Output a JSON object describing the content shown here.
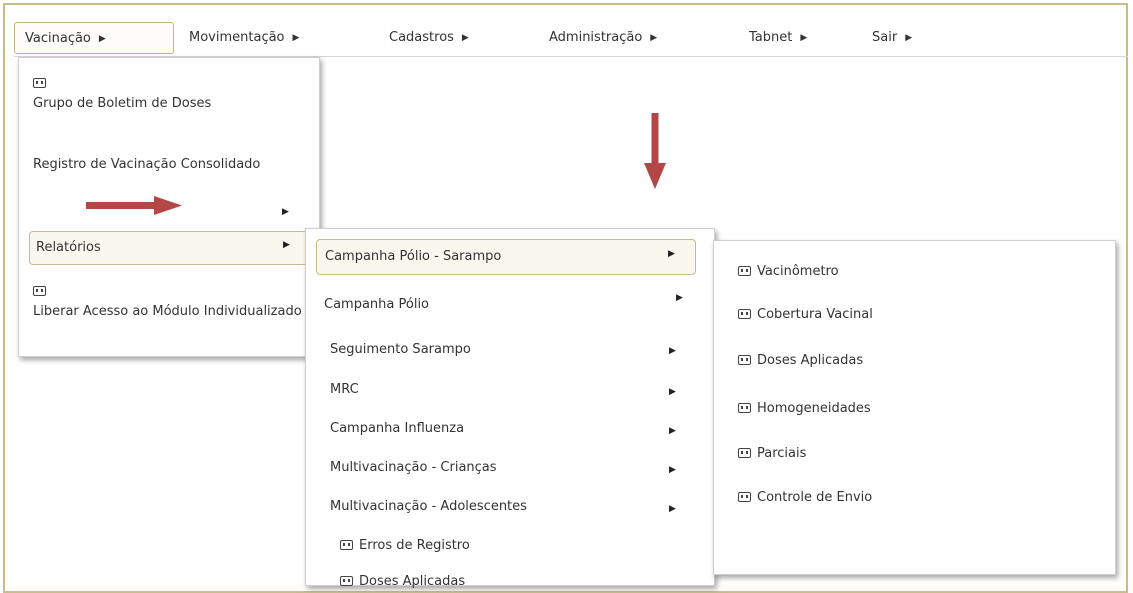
{
  "menubar": {
    "items": [
      {
        "label": "Vacinação",
        "arrow": "▶"
      },
      {
        "label": "Movimentação",
        "arrow": "▶"
      },
      {
        "label": "Cadastros",
        "arrow": "▶"
      },
      {
        "label": "Administração",
        "arrow": "▶"
      },
      {
        "label": "Tabnet",
        "arrow": "▶"
      },
      {
        "label": "Sair",
        "arrow": "▶"
      }
    ]
  },
  "vacinacao_menu": {
    "items": [
      {
        "label": "Grupo de Boletim de Doses",
        "icon": "window-icon"
      },
      {
        "label": "Registro de Vacinação Consolidado"
      },
      {
        "label": "",
        "arrow": "▶"
      },
      {
        "label": "Relatórios",
        "arrow": "▶"
      },
      {
        "label": "Liberar Acesso ao Módulo Individualizado",
        "icon": "window-icon"
      }
    ]
  },
  "relatorios_menu": {
    "items": [
      {
        "label": "Campanha Pólio - Sarampo",
        "arrow": "▶"
      },
      {
        "label": "Campanha Pólio",
        "arrow": "▶"
      },
      {
        "label": "Seguimento Sarampo",
        "arrow": "▶"
      },
      {
        "label": "MRC",
        "arrow": "▶"
      },
      {
        "label": "Campanha Influenza",
        "arrow": "▶"
      },
      {
        "label": "Multivacinação - Crianças",
        "arrow": "▶"
      },
      {
        "label": "Multivacinação - Adolescentes",
        "arrow": "▶"
      },
      {
        "label": "Erros de Registro",
        "icon": "window-icon"
      },
      {
        "label": "Doses Aplicadas",
        "icon": "window-icon"
      }
    ]
  },
  "campanha_polio_sarampo_menu": {
    "items": [
      {
        "label": "Vacinômetro",
        "icon": "window-icon"
      },
      {
        "label": "Cobertura Vacinal",
        "icon": "window-icon"
      },
      {
        "label": "Doses Aplicadas",
        "icon": "window-icon"
      },
      {
        "label": "Homogeneidades",
        "icon": "window-icon"
      },
      {
        "label": "Parciais",
        "icon": "window-icon"
      },
      {
        "label": "Controle de Envio",
        "icon": "window-icon"
      }
    ]
  },
  "colors": {
    "annotation_arrow": "#b34747",
    "frame_border": "#c8bd8a",
    "active_border": "#c4b484"
  }
}
